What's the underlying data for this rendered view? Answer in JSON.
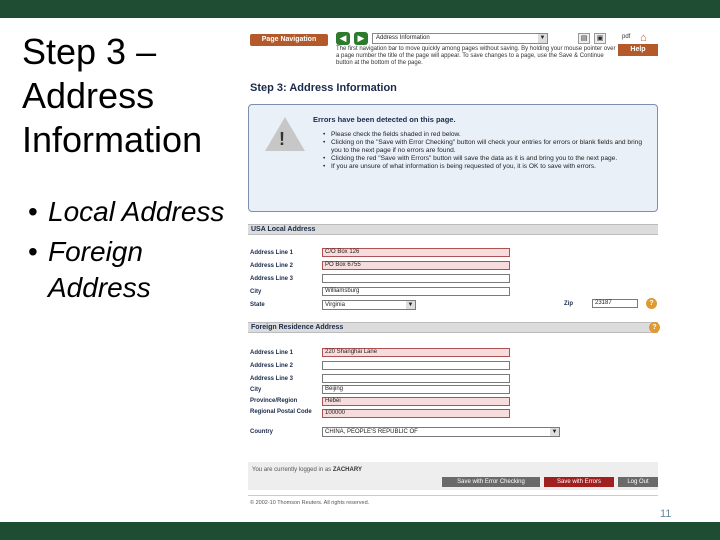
{
  "slide": {
    "title_line1": "Step 3 –",
    "title_line2": "Address",
    "title_line3": "Information",
    "bullets": [
      "Local Address",
      "Foreign Address"
    ],
    "bullet_symbol": "•",
    "page_number": "11"
  },
  "nav": {
    "page_navigation_label": "Page Navigation",
    "back_icon": "back-arrow-icon",
    "forward_icon": "forward-arrow-icon",
    "select_value": "Address Information",
    "help_label": "Help",
    "help_text": "The first navigation bar to move quickly among pages without saving. By holding your mouse pointer over a page number the title of the page will appear. To save changes to a page, use the Save & Continue button at the bottom of the page."
  },
  "heading": "Step 3: Address Information",
  "errors": {
    "title": "Errors have been detected on this page.",
    "items": [
      "Please check the fields shaded in red below.",
      "Clicking on the \"Save with Error Checking\" button will check your entries for errors or blank fields and bring you to the next page if no errors are found.",
      "Clicking the red \"Save with Errors\" button will save the data as it is and bring you to the next page.",
      "If you are unsure of what information is being requested of you, it is OK to save with errors."
    ]
  },
  "usa": {
    "section_title": "USA Local Address",
    "labels": [
      "Address Line 1",
      "Address Line 2",
      "Address Line 3",
      "City",
      "State"
    ],
    "values": [
      "C/O Box 126",
      "PO Box 6755",
      "",
      "Williamsburg",
      "Virginia"
    ],
    "zip_label": "Zip",
    "zip_value": "23187"
  },
  "foreign": {
    "section_title": "Foreign Residence Address",
    "labels": [
      "Address Line 1",
      "Address Line 2",
      "Address Line 3",
      "City",
      "Province/Region",
      "Regional Postal Code",
      "Country"
    ],
    "values": [
      "220 Shanghai Lane",
      "",
      "",
      "Beijing",
      "Hebei",
      "100000",
      "CHINA, PEOPLE'S REPUBLIC OF"
    ]
  },
  "footer": {
    "logged_in_prefix": "You are currently logged in as",
    "user": "ZACHARY",
    "save_error_checking": "Save with Error Checking",
    "save_with_errors": "Save with Errors",
    "logout": "Log Out",
    "copyright": "© 2002-10 Thomson Reuters. All rights reserved."
  },
  "colors": {
    "bar": "#1e4d34",
    "accent_orange": "#b45a2a",
    "error_red": "#a02020",
    "error_field_fill": "#f6dcdc"
  }
}
